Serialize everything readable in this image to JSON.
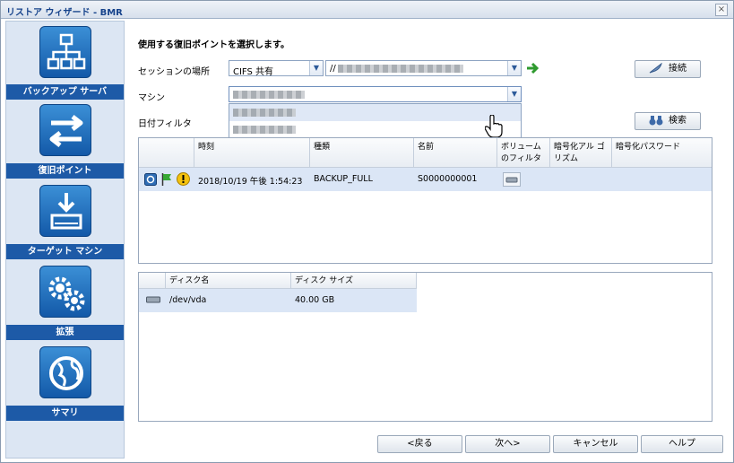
{
  "window": {
    "title": "リストア ウィザード - BMR",
    "close_glyph": "×"
  },
  "sidebar": {
    "items": [
      {
        "label": "バックアップ サーバ",
        "icon": "server-network-icon"
      },
      {
        "label": "復旧ポイント",
        "icon": "arrows-exchange-icon"
      },
      {
        "label": "ターゲット マシン",
        "icon": "download-drive-icon"
      },
      {
        "label": "拡張",
        "icon": "gears-icon"
      },
      {
        "label": "サマリ",
        "icon": "globe-icon"
      }
    ]
  },
  "main": {
    "heading": "使用する復旧ポイントを選択します。",
    "session_location_label": "セッションの場所",
    "session_type_value": "CIFS 共有",
    "session_path_prefix": "//",
    "connect_button": "接続",
    "machine_label": "マシン",
    "date_filter_label": "日付フィルタ",
    "search_button": "検索"
  },
  "recovery_table": {
    "columns": [
      "時刻",
      "種類",
      "名前",
      "ボリューム のフィルタ",
      "暗号化アル ゴリズム",
      "暗号化パスワード"
    ],
    "rows": [
      {
        "time": "2018/10/19 午後 1:54:23",
        "type": "BACKUP_FULL",
        "name": "S0000000001"
      }
    ]
  },
  "disk_table": {
    "columns": [
      "ディスク名",
      "ディスク サイズ"
    ],
    "rows": [
      {
        "name": "/dev/vda",
        "size": "40.00 GB"
      }
    ]
  },
  "footer": {
    "back": "<戻る",
    "next": "次へ>",
    "cancel": "キャンセル",
    "help": "ヘルプ"
  },
  "colors": {
    "accent": "#1d5aa7",
    "selected_row": "#dbe6f6",
    "go_arrow": "#2e9a2e"
  }
}
